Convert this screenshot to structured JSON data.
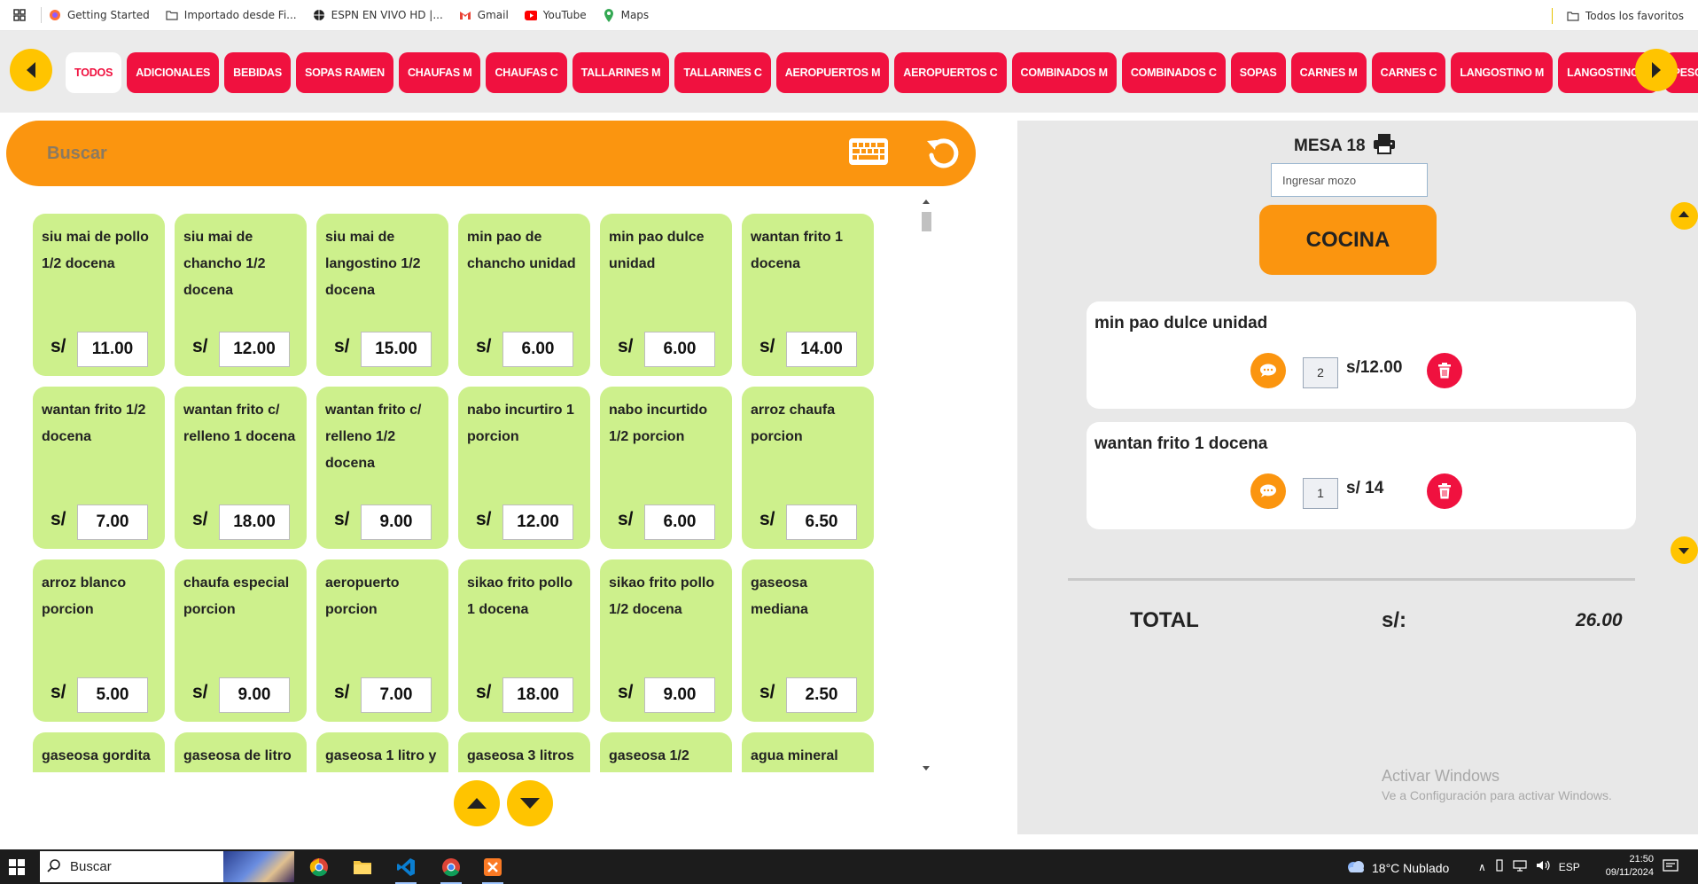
{
  "bookmarks": {
    "items": [
      {
        "label": "Getting Started",
        "icon": "firefox-icon"
      },
      {
        "label": "Importado desde Fi...",
        "icon": "folder-icon"
      },
      {
        "label": "ESPN EN VIVO HD |...",
        "icon": "globe-icon"
      },
      {
        "label": "Gmail",
        "icon": "gmail-icon"
      },
      {
        "label": "YouTube",
        "icon": "youtube-icon"
      },
      {
        "label": "Maps",
        "icon": "maps-icon"
      }
    ],
    "all_favorites": "Todos los favoritos"
  },
  "categories": [
    {
      "label": "TODOS",
      "active": true
    },
    {
      "label": "ADICIONALES"
    },
    {
      "label": "BEBIDAS"
    },
    {
      "label": "SOPAS RAMEN"
    },
    {
      "label": "CHAUFAS M"
    },
    {
      "label": "CHAUFAS C"
    },
    {
      "label": "TALLARINES M"
    },
    {
      "label": "TALLARINES C"
    },
    {
      "label": "AEROPUERTOS M"
    },
    {
      "label": "AEROPUERTOS C"
    },
    {
      "label": "COMBINADOS M"
    },
    {
      "label": "COMBINADOS C"
    },
    {
      "label": "SOPAS"
    },
    {
      "label": "CARNES M"
    },
    {
      "label": "CARNES C"
    },
    {
      "label": "LANGOSTINO M"
    },
    {
      "label": "LANGOSTINO C"
    },
    {
      "label": "PESCADOS C"
    }
  ],
  "search": {
    "placeholder": "Buscar"
  },
  "currency": "s/",
  "products": [
    {
      "name": "siu mai de pollo 1/2 docena",
      "price": "11.00"
    },
    {
      "name": "siu mai de chancho 1/2 docena",
      "price": "12.00"
    },
    {
      "name": "siu mai de langostino 1/2 docena",
      "price": "15.00"
    },
    {
      "name": "min pao de chancho unidad",
      "price": "6.00"
    },
    {
      "name": "min pao dulce unidad",
      "price": "6.00"
    },
    {
      "name": "wantan frito 1 docena",
      "price": "14.00"
    },
    {
      "name": "wantan frito 1/2 docena",
      "price": "7.00"
    },
    {
      "name": "wantan frito c/ relleno 1 docena",
      "price": "18.00"
    },
    {
      "name": "wantan frito c/ relleno 1/2 docena",
      "price": "9.00"
    },
    {
      "name": "nabo incurtiro 1 porcion",
      "price": "12.00"
    },
    {
      "name": "nabo incurtido 1/2 porcion",
      "price": "6.00"
    },
    {
      "name": "arroz chaufa porcion",
      "price": "6.50"
    },
    {
      "name": "arroz blanco porcion",
      "price": "5.00"
    },
    {
      "name": "chaufa especial porcion",
      "price": "9.00"
    },
    {
      "name": "aeropuerto porcion",
      "price": "7.00"
    },
    {
      "name": "sikao frito pollo 1 docena",
      "price": "18.00"
    },
    {
      "name": "sikao frito pollo 1/2 docena",
      "price": "9.00"
    },
    {
      "name": "gaseosa mediana",
      "price": "2.50"
    },
    {
      "name": "gaseosa gordita",
      "price": ""
    },
    {
      "name": "gaseosa de litro",
      "price": ""
    },
    {
      "name": "gaseosa 1 litro y",
      "price": ""
    },
    {
      "name": "gaseosa 3 litros",
      "price": ""
    },
    {
      "name": "gaseosa 1/2",
      "price": ""
    },
    {
      "name": "agua mineral",
      "price": ""
    }
  ],
  "order": {
    "table": "MESA 18",
    "waiter_placeholder": "Ingresar mozo",
    "kitchen_button": "COCINA",
    "items": [
      {
        "name": "min pao dulce unidad",
        "qty": "2",
        "price": "s/12.00"
      },
      {
        "name": "wantan frito 1 docena",
        "qty": "1",
        "price": "s/ 14"
      }
    ],
    "total_label": "TOTAL",
    "total_currency": "s/:",
    "total_value": "26.00"
  },
  "watermark": {
    "title": "Activar Windows",
    "subtitle": "Ve a Configuración para activar Windows."
  },
  "taskbar": {
    "search_placeholder": "Buscar",
    "weather": "18°C  Nublado",
    "lang": "ESP",
    "time": "21:50",
    "date": "09/11/2024"
  },
  "colors": {
    "accent_red": "#f0113f",
    "accent_orange": "#fb950f",
    "accent_yellow": "#ffc400",
    "card_green": "#cdf08c"
  }
}
